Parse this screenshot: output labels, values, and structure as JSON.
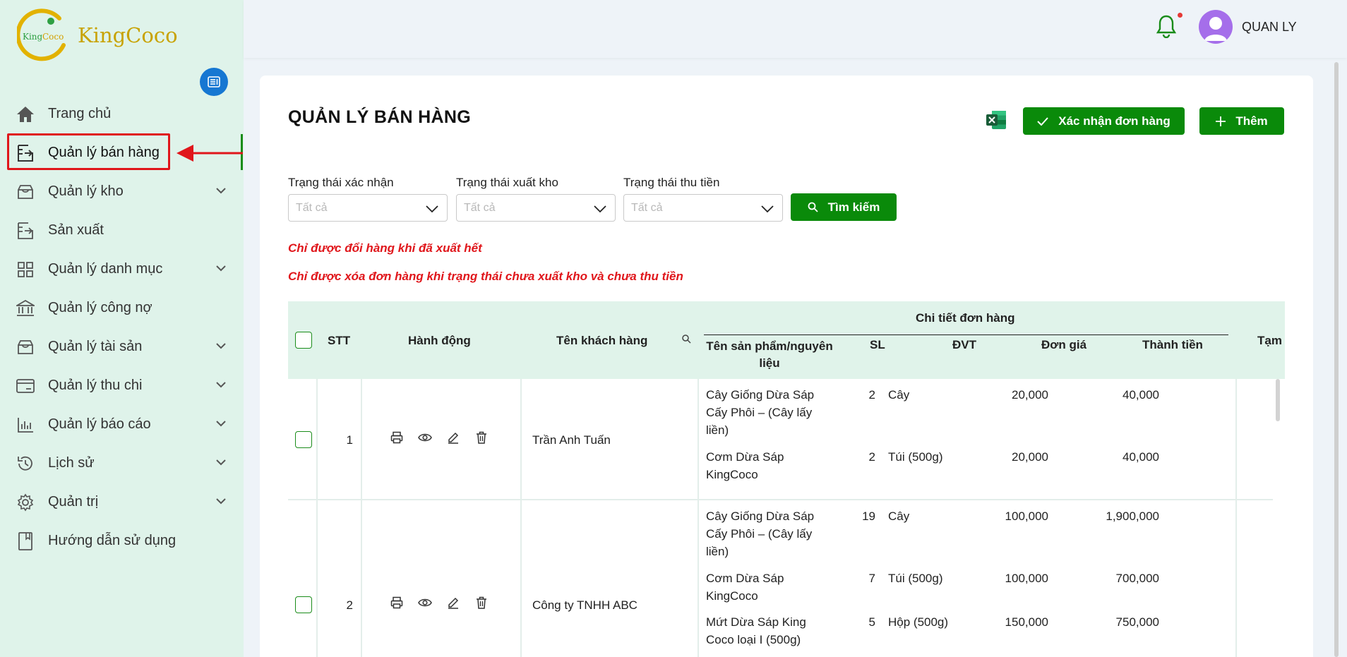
{
  "brand": {
    "name": "KingCoco",
    "logo_text": "KingCoco"
  },
  "sidebar": {
    "items": [
      {
        "label": "Trang chủ",
        "icon": "home-icon",
        "has_children": false
      },
      {
        "label": "Quản lý bán hàng",
        "icon": "sales-icon",
        "has_children": false,
        "active": true
      },
      {
        "label": "Quản lý kho",
        "icon": "warehouse-icon",
        "has_children": true
      },
      {
        "label": "Sản xuất",
        "icon": "production-icon",
        "has_children": false
      },
      {
        "label": "Quản lý danh mục",
        "icon": "grid-icon",
        "has_children": true
      },
      {
        "label": "Quản lý công nợ",
        "icon": "bank-icon",
        "has_children": false
      },
      {
        "label": "Quản lý tài sản",
        "icon": "box-icon",
        "has_children": true
      },
      {
        "label": "Quản lý thu chi",
        "icon": "card-icon",
        "has_children": true
      },
      {
        "label": "Quản lý báo cáo",
        "icon": "bar-chart-icon",
        "has_children": true
      },
      {
        "label": "Lịch sử",
        "icon": "history-icon",
        "has_children": true
      },
      {
        "label": "Quản trị",
        "icon": "gear-icon",
        "has_children": true
      },
      {
        "label": "Hướng dẫn sử dụng",
        "icon": "book-icon",
        "has_children": false
      }
    ]
  },
  "header": {
    "username": "QUAN LY",
    "notification_icon": "bell-icon"
  },
  "main": {
    "title": "QUẢN LÝ BÁN HÀNG",
    "buttons": {
      "confirm": "Xác nhận đơn hàng",
      "add": "Thêm",
      "search": "Tìm kiếm"
    },
    "filters": [
      {
        "label": "Trạng thái xác nhận",
        "placeholder": "Tất cả"
      },
      {
        "label": "Trạng thái xuất kho",
        "placeholder": "Tất cả"
      },
      {
        "label": "Trạng thái thu tiền",
        "placeholder": "Tất cả"
      }
    ],
    "notes": [
      "Chỉ được đổi hàng khi đã xuất hết",
      "Chỉ được xóa đơn hàng khi trạng thái chưa xuất kho và chưa thu tiền"
    ]
  },
  "table": {
    "headers": {
      "stt": "STT",
      "actions": "Hành động",
      "customer": "Tên khách hàng",
      "group": "Chi tiết đơn hàng",
      "product": "Tên sản phẩm/nguyên liệu",
      "qty": "SL",
      "unit": "ĐVT",
      "price": "Đơn giá",
      "total": "Thành tiền",
      "tam": "Tạm"
    },
    "rows": [
      {
        "stt": "1",
        "customer": "Trần Anh Tuấn",
        "items": [
          {
            "product": "Cây Giống Dừa Sáp Cấy Phôi – (Cây lấy liền)",
            "qty": "2",
            "unit": "Cây",
            "price": "20,000",
            "total": "40,000"
          },
          {
            "product": "Cơm Dừa Sáp KingCoco",
            "qty": "2",
            "unit": "Túi (500g)",
            "price": "20,000",
            "total": "40,000"
          }
        ]
      },
      {
        "stt": "2",
        "customer": "Công ty TNHH ABC",
        "items": [
          {
            "product": "Cây Giống Dừa Sáp Cấy Phôi – (Cây lấy liền)",
            "qty": "19",
            "unit": "Cây",
            "price": "100,000",
            "total": "1,900,000"
          },
          {
            "product": "Cơm Dừa Sáp KingCoco",
            "qty": "7",
            "unit": "Túi (500g)",
            "price": "100,000",
            "total": "700,000"
          },
          {
            "product": "Mứt Dừa Sáp King Coco loại I (500g)",
            "qty": "5",
            "unit": "Hộp (500g)",
            "price": "150,000",
            "total": "750,000"
          }
        ]
      }
    ]
  },
  "colors": {
    "primary": "#0a8a0a",
    "sidebar_bg": "#dff3ea",
    "warning": "#e0161b",
    "accent_blue": "#1677d2"
  }
}
